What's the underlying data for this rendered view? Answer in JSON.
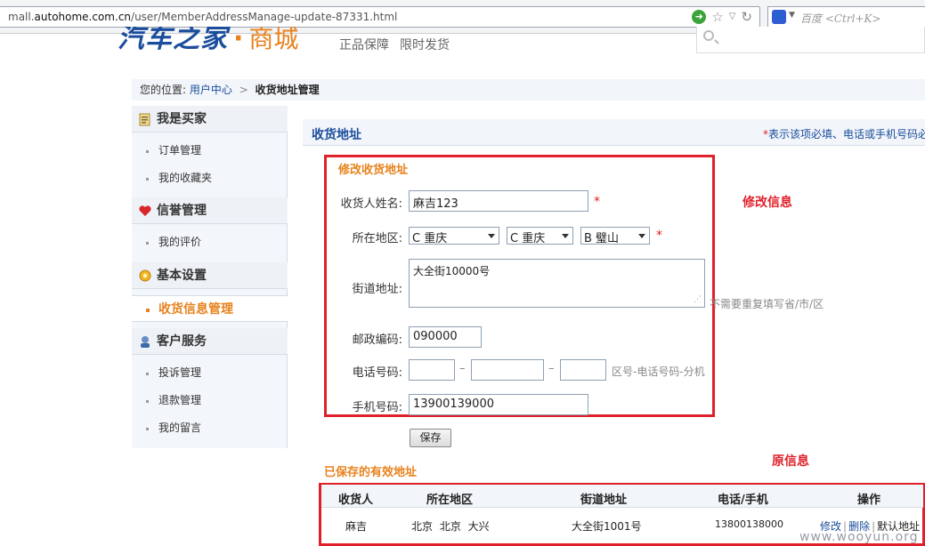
{
  "browser": {
    "url_prefix": "mall.",
    "url_domain": "autohome.com.cn",
    "url_path": "/user/MemberAddressManage-update-87331.html",
    "search_placeholder": "百度 <Ctrl+K>"
  },
  "header": {
    "logo_main": "汽车之家",
    "logo_dot": "·",
    "logo_sub": "商城",
    "slogan_1": "正品保障",
    "slogan_2": "限时发货"
  },
  "breadcrumb": {
    "prefix": "您的位置:",
    "link": "用户中心",
    "sep": ">",
    "current": "收货地址管理"
  },
  "sidebar": {
    "group_buyer": "我是买家",
    "item_orders": "订单管理",
    "item_favorites": "我的收藏夹",
    "group_credit": "信誉管理",
    "item_reviews": "我的评价",
    "group_settings": "基本设置",
    "item_address": "收货信息管理",
    "group_service": "客户服务",
    "item_complaint": "投诉管理",
    "item_refund": "退款管理",
    "item_messages": "我的留言"
  },
  "main": {
    "title": "收货地址",
    "note_star": "*",
    "note": "表示该项必填、电话或手机号码必"
  },
  "form": {
    "section_title": "修改收货地址",
    "name_label": "收货人姓名:",
    "name_value": "麻吉123",
    "region_label": "所在地区:",
    "province": "C 重庆",
    "city": "C 重庆",
    "district": "B 璧山",
    "street_label": "街道地址:",
    "street_value": "大全街10000号",
    "street_hint": "不需要重复填写省/市/区",
    "zip_label": "邮政编码:",
    "zip_value": "090000",
    "phone_label": "电话号码:",
    "phone_area": "",
    "phone_number": "",
    "phone_ext": "",
    "phone_dash": "–",
    "phone_hint": "区号-电话号码-分机",
    "mobile_label": "手机号码:",
    "mobile_value": "13900139000",
    "required_mark": "*",
    "save_label": "保存"
  },
  "annotations": {
    "modify": "修改信息",
    "original": "原信息"
  },
  "saved": {
    "title": "已保存的有效地址",
    "columns": [
      "收货人",
      "所在地区",
      "街道地址",
      "电话/手机",
      "操作"
    ],
    "rows": [
      {
        "name": "麻吉",
        "region": "北京  北京  大兴",
        "street": "大全街1001号",
        "phone": "13800138000",
        "op_edit": "修改",
        "op_sep": "|",
        "op_delete": "删除",
        "op_default": "默认地址"
      }
    ]
  },
  "watermark": "www.wooyun.org",
  "colors": {
    "accent_orange": "#e8821d",
    "brand_blue": "#1a4d9c",
    "annotation_red": "#e0202a"
  }
}
